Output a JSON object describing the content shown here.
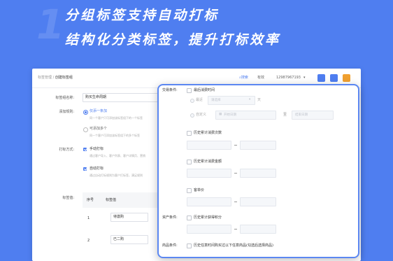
{
  "banner": {
    "bg_number": "1",
    "line1": "分组标签支持自动打标",
    "line2": "结构化分类标签，提升打标效率"
  },
  "topbar": {
    "breadcrumb_parent": "标签管理",
    "breadcrumb_sep": "/",
    "breadcrumb_current": "创建标签组",
    "search": "搜索",
    "tag": "有效",
    "phone": "12987967193",
    "icon_colors": [
      "#4f7ef0",
      "#4f7ef0",
      "#f0a030"
    ]
  },
  "form": {
    "group_name_label": "标签组名称:",
    "group_name_value": "购买生命周期",
    "rule_label": "添加规则:",
    "rule_option1": "仅添一条加",
    "rule_option1_hint": "同一个客户只可添加该标签组下的一个标签",
    "rule_option2": "可添加多个",
    "rule_option2_hint": "同一个客户可添加该标签组下的多个标签",
    "mode_label": "打标方式:",
    "mode_manual": "手动打标",
    "mode_manual_hint": "通过客户导入、客户列表、客户详情页、营销",
    "mode_auto": "自动打标",
    "mode_auto_hint": "通过自动打标规则为客户打标签，满足规则",
    "value_label": "标签值:",
    "table_headers": [
      "序号",
      "标签值"
    ],
    "rows": [
      {
        "index": "1",
        "value": "待激购"
      },
      {
        "index": "2",
        "value": "已二购"
      }
    ]
  },
  "popup": {
    "trade_label": "交易条件:",
    "last_consume": "最后消费时间",
    "within": "最近",
    "select_ph": "请选择",
    "days": "天",
    "custom": "自定义",
    "start_date_ph": "开始日期",
    "to": "至",
    "end_date_ph": "结束日期",
    "hist_count": "历史累计消费次数",
    "hist_amount": "历史累计消费金额",
    "unit_price": "客单价",
    "asset_label": "资产条件:",
    "points": "历史累计获得积分",
    "goods_label": "商品条件:",
    "goods_text": "历史任意时间购买过以下任意商品(勾选后选择商品)",
    "range_sep": "-"
  }
}
